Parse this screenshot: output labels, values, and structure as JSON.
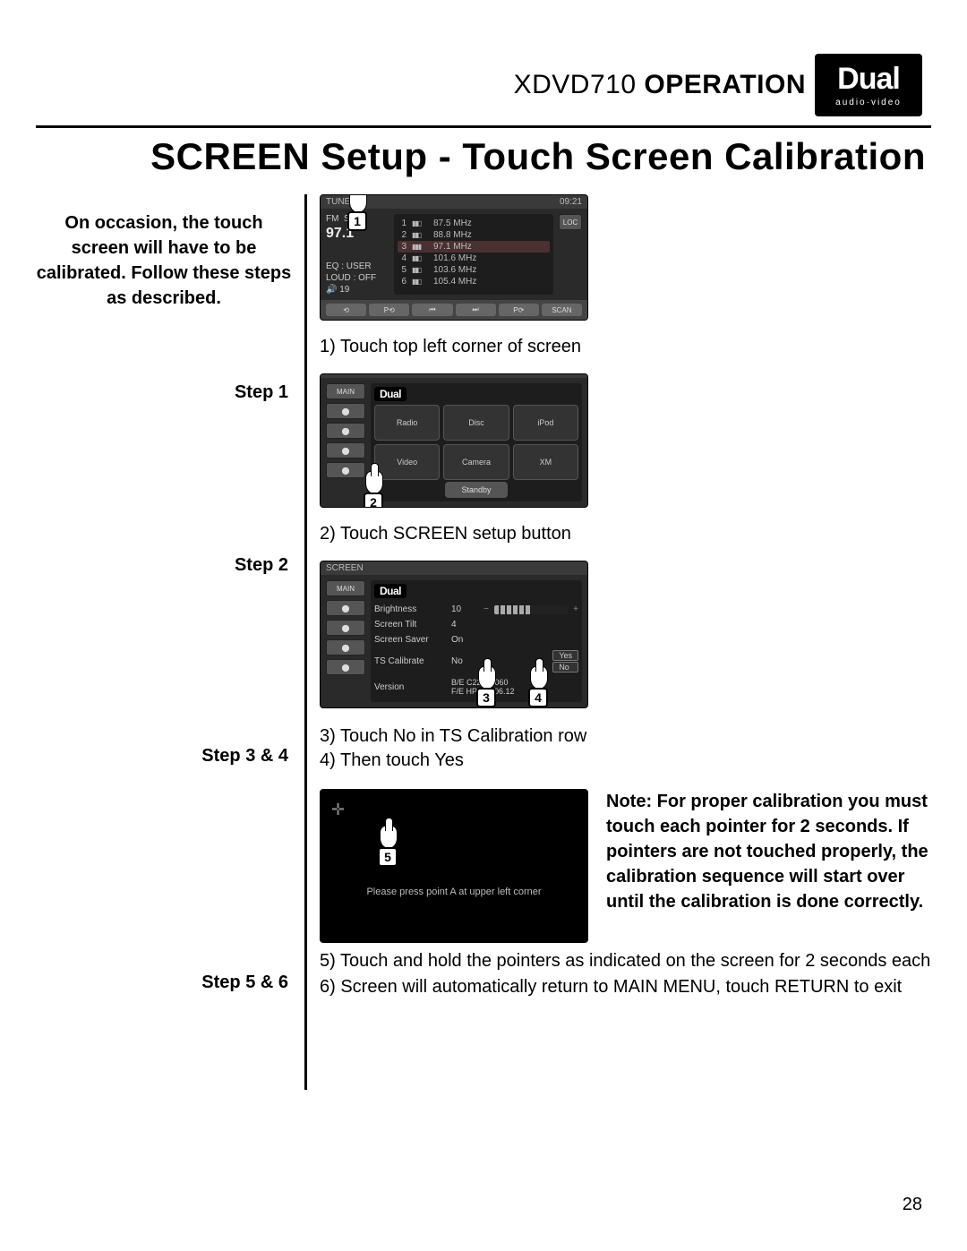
{
  "header": {
    "model": "XDVD710",
    "operation": "OPERATION",
    "logo_main": "Dual",
    "logo_sub": "audio·video"
  },
  "title": "SCREEN Setup - Touch Screen Calibration",
  "intro": "On occasion, the touch screen will have to be calibrated. Follow these steps as described.",
  "labels": {
    "step1": "Step 1",
    "step2": "Step 2",
    "step34": "Step 3 & 4",
    "step56": "Step 5 & 6"
  },
  "captions": {
    "c1": "1) Touch top left corner of screen",
    "c2": "2) Touch SCREEN setup button",
    "c3a": "3) Touch No in TS Calibration row",
    "c3b": "4) Then touch Yes",
    "c5": "5) Touch and hold the pointers as indicated on the screen for 2 seconds each",
    "c6": "6) Screen will automatically return to MAIN MENU, touch RETURN to exit"
  },
  "callouts": {
    "n1": "1",
    "n2": "2",
    "n3": "3",
    "n4": "4",
    "n5": "5"
  },
  "note": "Note: For proper calibration you must touch each pointer for 2 seconds. If pointers are not touched properly, the calibration sequence will start over until the calibration is done correctly.",
  "page_number": "28",
  "shot1": {
    "header_left": "TUNER",
    "clock": "09:21",
    "band": "FM",
    "st": "ST",
    "freq_main": "97.1",
    "unit": "MHz",
    "loc": "LOC",
    "eq_label": "EQ",
    "eq_val": "USER",
    "loud_label": "LOUD",
    "loud_val": "OFF",
    "vol_icon": "🔊",
    "vol_val": "19",
    "presets": [
      {
        "n": "1",
        "f": "87.5 MHz"
      },
      {
        "n": "2",
        "f": "88.8 MHz"
      },
      {
        "n": "3",
        "f": "97.1 MHz"
      },
      {
        "n": "4",
        "f": "101.6 MHz"
      },
      {
        "n": "5",
        "f": "103.6 MHz"
      },
      {
        "n": "6",
        "f": "105.4 MHz"
      }
    ],
    "controls": [
      "⟲",
      "P⟲",
      "⏮",
      "⏭",
      "P⟳",
      "SCAN"
    ]
  },
  "shot2": {
    "main": "MAIN",
    "dual": "Dual",
    "standby": "Standby",
    "tiles": [
      "Radio",
      "Disc",
      "iPod",
      "Video",
      "Camera",
      "XM"
    ]
  },
  "shot3": {
    "header": "SCREEN",
    "main": "MAIN",
    "dual": "Dual",
    "rows": {
      "brightness_lbl": "Brightness",
      "brightness_val": "10",
      "tilt_lbl": "Screen Tilt",
      "tilt_val": "4",
      "saver_lbl": "Screen Saver",
      "saver_val": "On",
      "ts_lbl": "TS Calibrate",
      "ts_val": "No",
      "ver_lbl": "Version",
      "ver_a": "B/E C22.01.060",
      "ver_b": "F/E HPD60.06.12"
    },
    "yes": "Yes",
    "no": "No"
  },
  "shot4": {
    "msg": "Please press point A at upper left corner"
  }
}
